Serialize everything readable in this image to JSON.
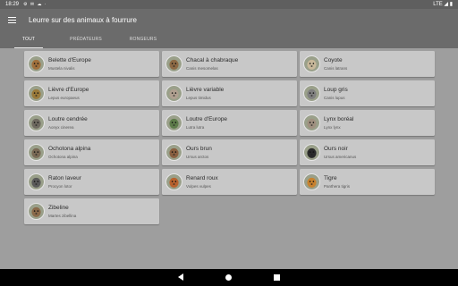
{
  "status": {
    "time": "18:29",
    "icons": "⚙ ✉ ☁ ·",
    "right": "LTE ◢ ▮"
  },
  "app": {
    "title": "Leurre sur des animaux à fourrure"
  },
  "tabs": [
    {
      "label": "TOUT",
      "active": true
    },
    {
      "label": "PRÉDATEURS",
      "active": false
    },
    {
      "label": "RONGEURS",
      "active": false
    }
  ],
  "animals": [
    {
      "name": "Belette d'Europe",
      "scientific": "Mustela nivalis",
      "color": "#a0703c"
    },
    {
      "name": "Chacal à chabraque",
      "scientific": "Canis mesomelas",
      "color": "#8d6a45"
    },
    {
      "name": "Coyote",
      "scientific": "Canis latrans",
      "color": "#c8b89a"
    },
    {
      "name": "Lièvre d'Europe",
      "scientific": "Lepus europaeus",
      "color": "#9a7a3a"
    },
    {
      "name": "Lièvre variable",
      "scientific": "Lepus timidus",
      "color": "#b0a090"
    },
    {
      "name": "Loup gris",
      "scientific": "Canis lupus",
      "color": "#7f7f7f"
    },
    {
      "name": "Loutre cendrée",
      "scientific": "Aonyx cinerea",
      "color": "#6f6a60"
    },
    {
      "name": "Loutre d'Europe",
      "scientific": "Lutra lutra",
      "color": "#5e7c4a"
    },
    {
      "name": "Lynx boréal",
      "scientific": "Lynx lynx",
      "color": "#a09080"
    },
    {
      "name": "Ochotona alpina",
      "scientific": "Ochotona alpina",
      "color": "#7a6a55"
    },
    {
      "name": "Ours brun",
      "scientific": "Ursus arctos",
      "color": "#8a6040"
    },
    {
      "name": "Ours noir",
      "scientific": "Ursus americanus",
      "color": "#2a2a2a"
    },
    {
      "name": "Raton laveur",
      "scientific": "Procyon lotor",
      "color": "#5a5a5a"
    },
    {
      "name": "Renard roux",
      "scientific": "Vulpes vulpes",
      "color": "#b8622e"
    },
    {
      "name": "Tigre",
      "scientific": "Panthera tigris",
      "color": "#c8822e"
    },
    {
      "name": "Zibeline",
      "scientific": "Martes zibellina",
      "color": "#8a6a4a"
    }
  ]
}
